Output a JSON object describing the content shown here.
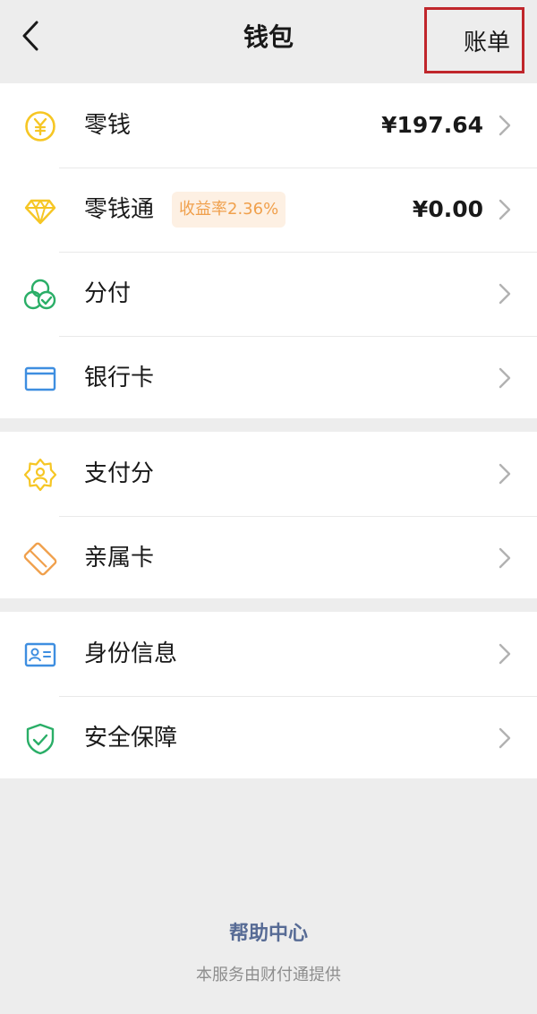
{
  "nav": {
    "title": "钱包",
    "right_action": "账单",
    "highlight_color": "#c0262b"
  },
  "groups": [
    {
      "items": [
        {
          "label": "零钱",
          "icon": "yen-coin-icon",
          "value": "¥197.64"
        },
        {
          "label": "零钱通",
          "icon": "diamond-icon",
          "badge": "收益率2.36%",
          "value": "¥0.00"
        },
        {
          "label": "分付",
          "icon": "fenfu-icon"
        },
        {
          "label": "银行卡",
          "icon": "bank-card-icon"
        }
      ]
    },
    {
      "items": [
        {
          "label": "支付分",
          "icon": "pay-score-badge-icon"
        },
        {
          "label": "亲属卡",
          "icon": "family-card-icon"
        }
      ]
    },
    {
      "items": [
        {
          "label": "身份信息",
          "icon": "id-card-icon"
        },
        {
          "label": "安全保障",
          "icon": "security-shield-icon"
        }
      ]
    }
  ],
  "footer": {
    "help_link": "帮助中心",
    "provider_text": "本服务由财付通提供"
  },
  "colors": {
    "link": "#576b95",
    "badge_bg": "#fdf0e3",
    "badge_text": "#f0a04c",
    "green": "#2aae67",
    "yellow": "#f6c624",
    "blue": "#3e8ee0",
    "orange": "#f0a04c"
  }
}
